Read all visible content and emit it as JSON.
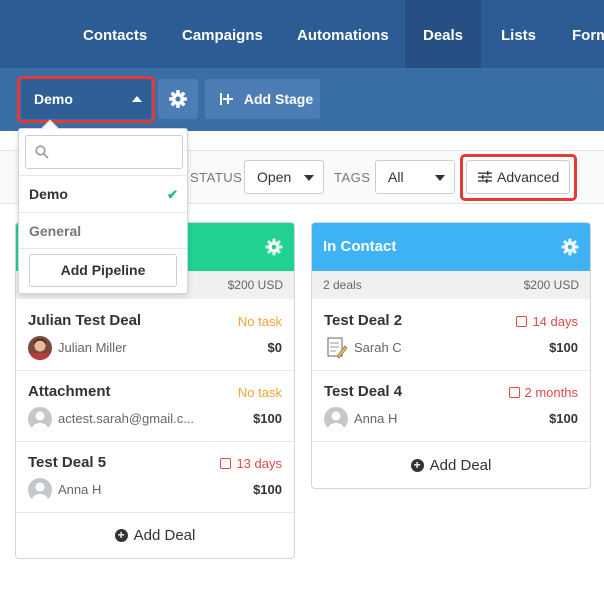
{
  "nav": {
    "items": [
      {
        "label": "Contacts"
      },
      {
        "label": "Campaigns"
      },
      {
        "label": "Automations"
      },
      {
        "label": "Deals",
        "active": true
      },
      {
        "label": "Lists"
      },
      {
        "label": "Form"
      }
    ]
  },
  "toolbar": {
    "pipeline_select": "Demo",
    "add_stage_label": "Add Stage",
    "gear_icon": "gear-icon"
  },
  "filters": {
    "status_label": "STATUS",
    "status_value": "Open",
    "tags_label": "TAGS",
    "tags_value": "All",
    "advanced_label": "Advanced"
  },
  "dropdown": {
    "search_placeholder": "",
    "items": [
      {
        "label": "Demo",
        "selected": true
      },
      {
        "label": "General"
      }
    ],
    "add_pipeline_label": "Add Pipeline"
  },
  "columns": [
    {
      "title": "",
      "color": "#20d18f",
      "deal_count": "",
      "total": "$200 USD",
      "deals": [
        {
          "name": "Julian Test Deal",
          "task": "No task",
          "person": "Julian Miller",
          "amount": "$0"
        },
        {
          "name": "Attachment",
          "task": "No task",
          "person": "actest.sarah@gmail.c...",
          "amount": "$100"
        },
        {
          "name": "Test Deal 5",
          "task": "13 days",
          "person": "Anna H",
          "amount": "$100"
        }
      ],
      "add_deal_label": "Add Deal"
    },
    {
      "title": "In Contact",
      "color": "#3fb2f5",
      "deal_count": "2 deals",
      "total": "$200 USD",
      "deals": [
        {
          "name": "Test Deal 2",
          "task": "14 days",
          "person": "Sarah C",
          "amount": "$100"
        },
        {
          "name": "Test Deal 4",
          "task": "2 months",
          "person": "Anna H",
          "amount": "$100"
        }
      ],
      "add_deal_label": "Add Deal"
    }
  ],
  "colors": {
    "nav_bg": "#2d5b94",
    "toolbar_bg": "#3a6ea6",
    "highlight": "#e53935",
    "no_task": "#f2a33a",
    "overdue": "#e24a4a",
    "check": "#20c07a"
  }
}
